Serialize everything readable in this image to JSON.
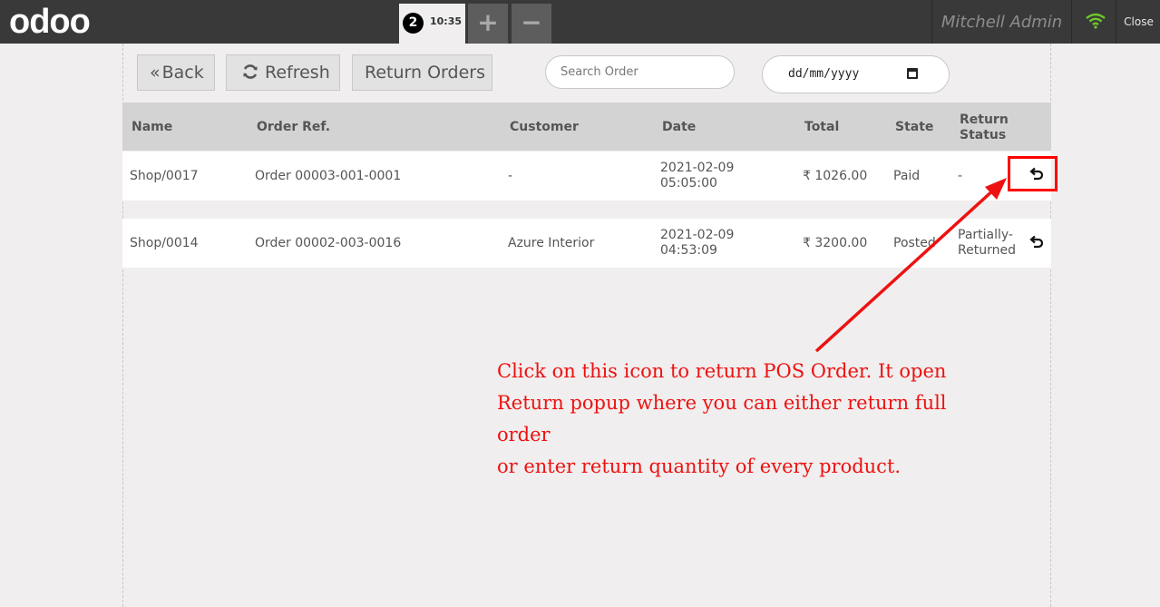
{
  "header": {
    "logo": "odoo",
    "order_number": "2",
    "order_time": "10:35",
    "add_order": "+",
    "remove_order": "−",
    "user": "Mitchell Admin",
    "close": "Close"
  },
  "toolbar": {
    "back": "Back",
    "refresh": "Refresh",
    "return_orders": "Return Orders",
    "search_placeholder": "Search Order",
    "date_placeholder": "dd/mm/yyyy"
  },
  "table": {
    "columns": [
      "Name",
      "Order Ref.",
      "Customer",
      "Date",
      "Total",
      "State",
      "Return",
      "Status"
    ],
    "rows": [
      {
        "name": "Shop/0017",
        "ref": "Order 00003-001-0001",
        "customer": "-",
        "date": "2021-02-09",
        "time": "05:05:00",
        "total": "₹ 1026.00",
        "state": "Paid",
        "return_status_1": "-",
        "return_status_2": ""
      },
      {
        "name": "Shop/0014",
        "ref": "Order 00002-003-0016",
        "customer": "Azure Interior",
        "date": "2021-02-09",
        "time": "04:53:09",
        "total": "₹ 3200.00",
        "state": "Posted",
        "return_status_1": "Partially-",
        "return_status_2": "Returned"
      }
    ]
  },
  "annotation": {
    "line1": "Click on this icon to return POS Order. It open",
    "line2": "Return popup where you can either return full order",
    "line3": "or enter return quantity of every product."
  },
  "colors": {
    "topbar": "#393939",
    "background": "#f0eeee",
    "annotation": "#ee1111",
    "wifi": "#6ec72b"
  }
}
